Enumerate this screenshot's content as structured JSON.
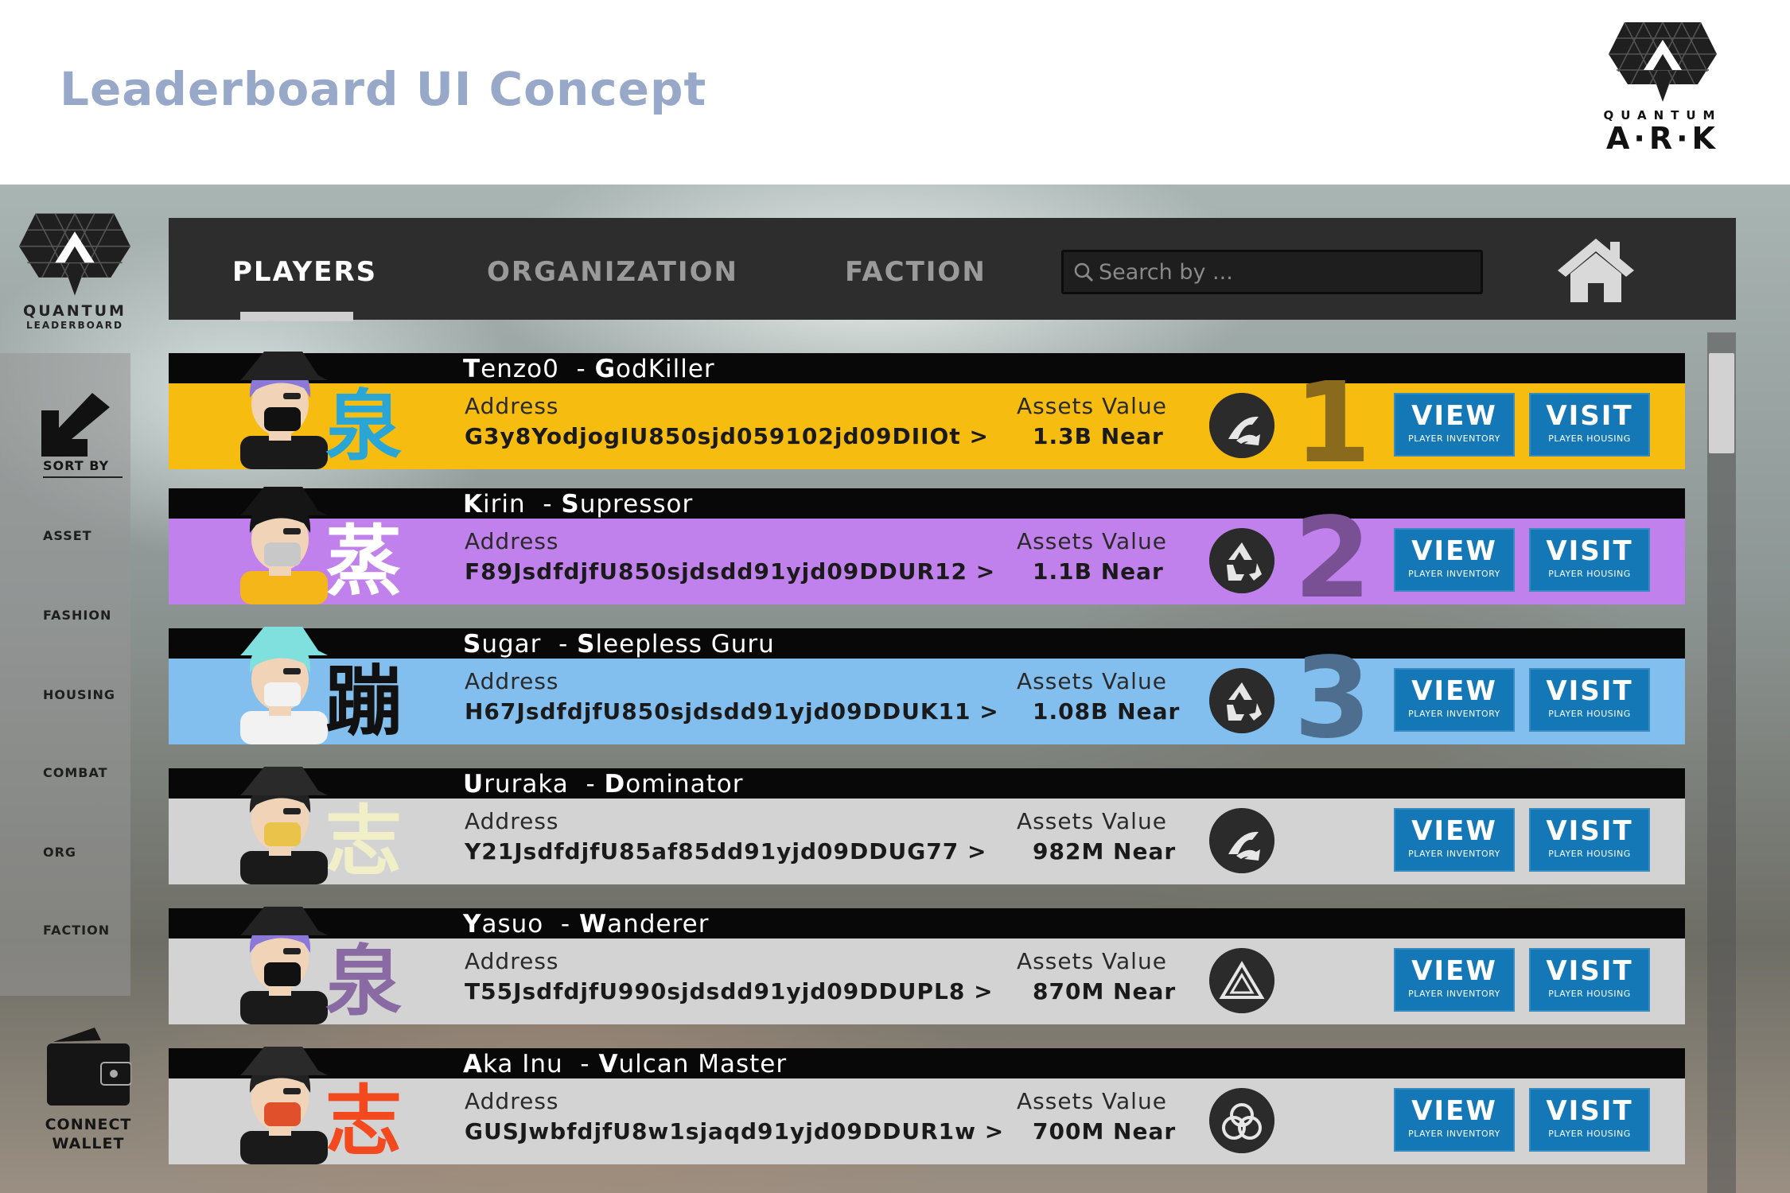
{
  "header": {
    "title": "Leaderboard UI Concept",
    "brand_top": "QUANTUM",
    "brand_main": "A·R·K"
  },
  "sidebar": {
    "logo_title": "QUANTUM",
    "logo_sub": "LEADERBOARD",
    "sort_label": "SORT BY",
    "sort_items": [
      "ASSET",
      "FASHION",
      "HOUSING",
      "COMBAT",
      "ORG",
      "FACTION"
    ],
    "wallet_label_1": "CONNECT",
    "wallet_label_2": "WALLET"
  },
  "nav": {
    "tabs": [
      "PLAYERS",
      "ORGANIZATION",
      "FACTION"
    ],
    "active_tab": "PLAYERS",
    "search_placeholder": "Search by ..."
  },
  "labels": {
    "address": "Address",
    "assets": "Assets Value",
    "view": "VIEW",
    "view_sub": "PLAYER INVENTORY",
    "visit": "VISIT",
    "visit_sub": "PLAYER HOUSING"
  },
  "rows": [
    {
      "name": "Tenzo0",
      "title": "GodKiller",
      "address": "G3y8YodjogIU850sjd059102jd09DIIOt  >",
      "assets": "1.3B Near",
      "rank": "1",
      "color": "#f6bd10",
      "rank_color": "#8a6a1c",
      "kanji": "泉",
      "kanji_color": "#2aa6d6",
      "badge": "fan-icon"
    },
    {
      "name": "Kirin",
      "title": "Supressor",
      "address": "F89JsdfdjfU850sjdsdd91yjd09DDUR12  >",
      "assets": "1.1B Near",
      "rank": "2",
      "color": "#c181ec",
      "rank_color": "#7a5094",
      "kanji": "蒸",
      "kanji_color": "#ffffff",
      "badge": "recycle-icon"
    },
    {
      "name": "Sugar",
      "title": "Sleepless Guru",
      "address": "H67JsdfdjfU850sjdsdd91yjd09DDUK11  >",
      "assets": "1.08B Near",
      "rank": "3",
      "color": "#82bfee",
      "rank_color": "#4d6e8e",
      "kanji": "蹦",
      "kanji_color": "#111111",
      "badge": "recycle-icon"
    },
    {
      "name": "Ururaka",
      "title": "Dominator",
      "address": "Y21JsdfdjfU85af85dd91yjd09DDUG77  >",
      "assets": "982M Near",
      "rank": "",
      "color": "#d3d3d3",
      "rank_color": "#d3d3d3",
      "kanji": "志",
      "kanji_color": "#f0efc8",
      "badge": "fan-icon"
    },
    {
      "name": "Yasuo",
      "title": "Wanderer",
      "address": "T55JsdfdjfU990sjdsdd91yjd09DDUPL8  >",
      "assets": "870M Near",
      "rank": "",
      "color": "#d3d3d3",
      "rank_color": "#d3d3d3",
      "kanji": "泉",
      "kanji_color": "#8a6aa3",
      "badge": "triangle-icon"
    },
    {
      "name": "Aka Inu",
      "title": "Vulcan Master",
      "address": "GUSJwbfdjfU8w1sjaqd91yjd09DDUR1w  >",
      "assets": "700M Near",
      "rank": "",
      "color": "#d3d3d3",
      "rank_color": "#d3d3d3",
      "kanji": "志",
      "kanji_color": "#f24a1e",
      "badge": "knot-icon"
    }
  ]
}
